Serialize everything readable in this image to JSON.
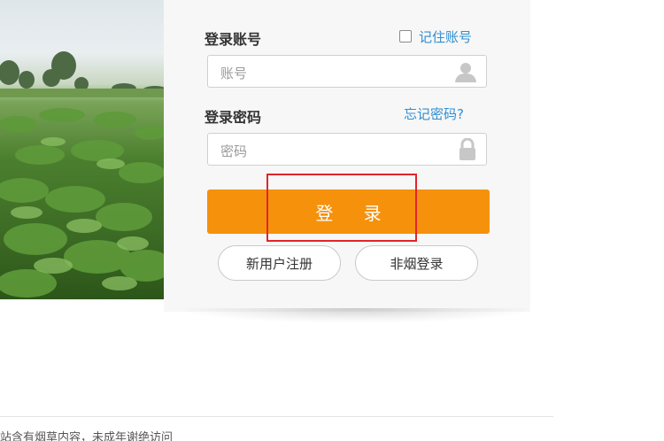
{
  "header": {
    "title": ""
  },
  "login": {
    "account_label": "登录账号",
    "remember_label": "记住账号",
    "account_placeholder": "账号",
    "password_label": "登录密码",
    "forgot_label": "忘记密码?",
    "password_placeholder": "密码",
    "submit_label": "登 录",
    "register_label": "新用户注册",
    "non_tobacco_label": "非烟登录"
  },
  "footer": {
    "notice": "站含有烟草内容，未成年谢绝访问"
  },
  "colors": {
    "primary_button": "#f6910c",
    "link": "#2f8fd3",
    "highlight": "#e0262a"
  },
  "icons": {
    "account_field": "user-icon",
    "password_field": "lock-icon"
  }
}
